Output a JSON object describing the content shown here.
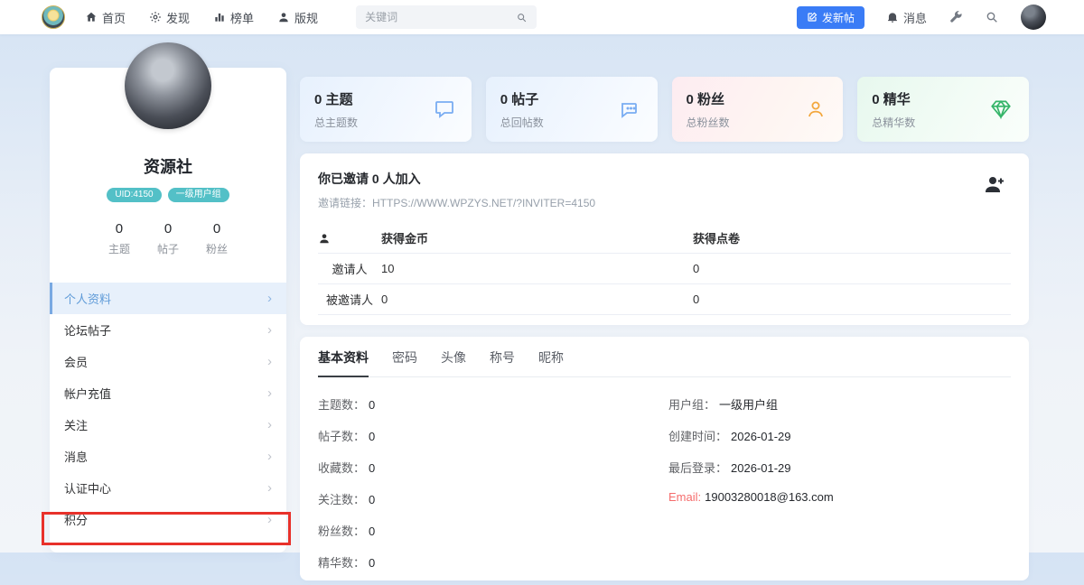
{
  "navbar": {
    "items": [
      {
        "label": "首页",
        "icon": "home-icon"
      },
      {
        "label": "发现",
        "icon": "gear-icon"
      },
      {
        "label": "榜单",
        "icon": "chart-icon"
      },
      {
        "label": "版规",
        "icon": "person-icon"
      }
    ],
    "search_placeholder": "关键词",
    "new_post_button": "发新帖",
    "messages_label": "消息"
  },
  "profile": {
    "name": "资源社",
    "uid_badge": "UID:4150",
    "group_badge": "一级用户组",
    "mini_stats": [
      {
        "value": "0",
        "label": "主题"
      },
      {
        "value": "0",
        "label": "帖子"
      },
      {
        "value": "0",
        "label": "粉丝"
      }
    ],
    "menu": [
      {
        "label": "个人资料"
      },
      {
        "label": "论坛帖子"
      },
      {
        "label": "会员"
      },
      {
        "label": "帐户充值"
      },
      {
        "label": "关注"
      },
      {
        "label": "消息"
      },
      {
        "label": "认证中心"
      },
      {
        "label": "积分"
      }
    ]
  },
  "stat_cards": [
    {
      "title": "0 主题",
      "subtitle": "总主题数",
      "icon": "comment-icon",
      "theme": "blue"
    },
    {
      "title": "0 帖子",
      "subtitle": "总回帖数",
      "icon": "comments-icon",
      "theme": "blue"
    },
    {
      "title": "0 粉丝",
      "subtitle": "总粉丝数",
      "icon": "user-icon",
      "theme": "pink"
    },
    {
      "title": "0 精华",
      "subtitle": "总精华数",
      "icon": "diamond-icon",
      "theme": "green"
    }
  ],
  "invite": {
    "title": "你已邀请 0 人加入",
    "link_prefix": "邀请链接：",
    "link_url": "HTTPS://WWW.WPZYS.NET/?INVITER=4150",
    "table": {
      "gold_header": "获得金币",
      "points_header": "获得点卷",
      "rows": [
        {
          "label": "邀请人",
          "gold": "10",
          "points": "0"
        },
        {
          "label": "被邀请人",
          "gold": "0",
          "points": "0"
        }
      ]
    }
  },
  "details": {
    "tabs": [
      {
        "label": "基本资料"
      },
      {
        "label": "密码"
      },
      {
        "label": "头像"
      },
      {
        "label": "称号"
      },
      {
        "label": "昵称"
      }
    ],
    "left": [
      {
        "label": "主题数：",
        "value": "0"
      },
      {
        "label": "帖子数：",
        "value": "0"
      },
      {
        "label": "收藏数：",
        "value": "0"
      },
      {
        "label": "关注数：",
        "value": "0"
      },
      {
        "label": "粉丝数：",
        "value": "0"
      },
      {
        "label": "精华数：",
        "value": "0"
      }
    ],
    "right": [
      {
        "label": "用户组：",
        "value": "一级用户组"
      },
      {
        "label": "创建时间：",
        "value": "2026-01-29"
      },
      {
        "label": "最后登录：",
        "value": "2026-01-29"
      },
      {
        "label": "Email:",
        "value": "19003280018@163.com"
      }
    ]
  },
  "colors": {
    "accent_blue": "#3a7cf6",
    "badge_teal": "#53c0c7",
    "annotation_red": "#e8312a",
    "email_red": "#f56c6c"
  }
}
